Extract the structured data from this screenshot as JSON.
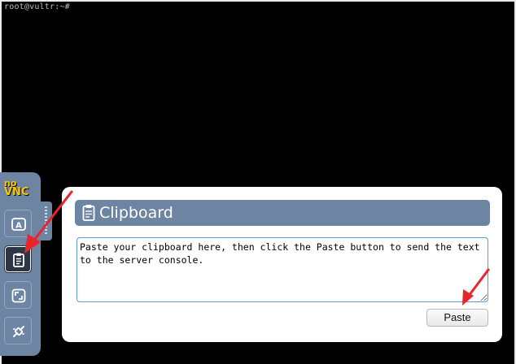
{
  "terminal": {
    "prompt": "root@vultr:~#"
  },
  "control_bar": {
    "logo_top": "no",
    "logo_bottom": "VNC",
    "buttons": [
      {
        "name": "extra-keys",
        "icon": "keyboard-a-icon"
      },
      {
        "name": "clipboard",
        "icon": "clipboard-icon",
        "selected": true
      },
      {
        "name": "fullscreen",
        "icon": "fullscreen-icon"
      },
      {
        "name": "disconnect",
        "icon": "disconnect-icon"
      }
    ]
  },
  "clipboard_panel": {
    "title": "Clipboard",
    "textarea_value": "Paste your clipboard here, then click the Paste button to send the text to the server console.",
    "paste_label": "Paste"
  },
  "colors": {
    "terminal_bg": "#000000",
    "bar_bg": "#6e84a3",
    "annotation_red": "#e8262a",
    "logo_yellow": "#f8c700"
  }
}
